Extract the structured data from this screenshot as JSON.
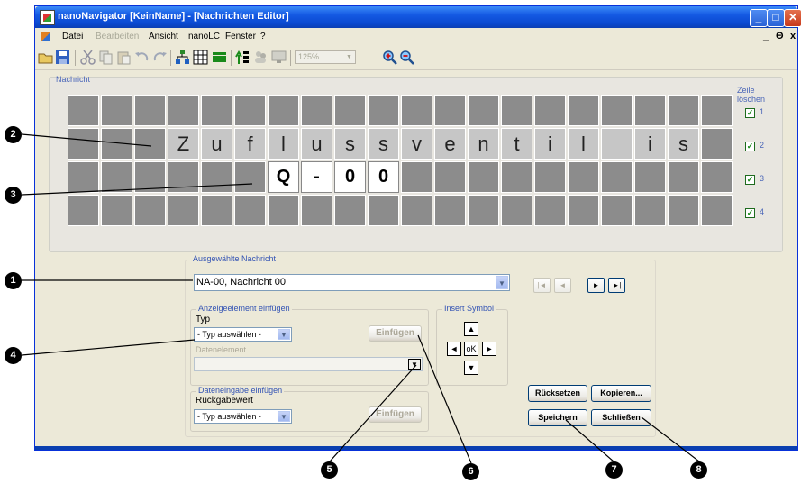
{
  "window": {
    "title": "nanoNavigator [KeinName] - [Nachrichten Editor]"
  },
  "menu": {
    "items": [
      {
        "label": "Datei",
        "enabled": true
      },
      {
        "label": "Bearbeiten",
        "enabled": false
      },
      {
        "label": "Ansicht",
        "enabled": true
      },
      {
        "label": "nanoLC",
        "enabled": true
      },
      {
        "label": "Fenster",
        "enabled": true
      },
      {
        "label": "?",
        "enabled": true
      }
    ],
    "mdi_controls": [
      "_",
      "Θ",
      "x"
    ]
  },
  "toolbar": {
    "zoom": "125%"
  },
  "message_panel": {
    "title": "Nachricht",
    "clear_rows_label": "Zeile löschen",
    "rows": [
      {
        "number": "1",
        "checked": true,
        "cells": [
          "",
          "",
          "",
          "",
          "",
          "",
          "",
          "",
          "",
          "",
          "",
          "",
          "",
          "",
          "",
          "",
          "",
          "",
          "",
          ""
        ]
      },
      {
        "number": "2",
        "checked": true,
        "cells": [
          "",
          "",
          "",
          "Z",
          "u",
          "f",
          "l",
          "u",
          "s",
          "s",
          "v",
          "e",
          "n",
          "t",
          "i",
          "l",
          "",
          "i",
          "s",
          ""
        ]
      },
      {
        "number": "3",
        "checked": true,
        "cells": [
          "",
          "",
          "",
          "",
          "",
          "",
          "Q",
          "-",
          "0",
          "0",
          "",
          "",
          "",
          "",
          "",
          "",
          "",
          "",
          "",
          ""
        ]
      },
      {
        "number": "4",
        "checked": true,
        "cells": [
          "",
          "",
          "",
          "",
          "",
          "",
          "",
          "",
          "",
          "",
          "",
          "",
          "",
          "",
          "",
          "",
          "",
          "",
          "",
          ""
        ]
      }
    ]
  },
  "selected_message": {
    "title": "Ausgewählte Nachricht",
    "value": "NA-00,  Nachricht 00"
  },
  "nav_buttons": [
    "|◄",
    "◄",
    "►",
    "►|"
  ],
  "insert_element": {
    "title": "Anzeigeelement einfügen",
    "type_label": "Typ",
    "type_value": "- Typ auswählen -",
    "data_label": "Datenelement",
    "button": "Einfügen"
  },
  "insert_symbol": {
    "title": "Insert Symbol",
    "ok": "oK"
  },
  "data_entry": {
    "title": "Dateneingabe einfügen",
    "return_label": "Rückgabewert",
    "type_value": "- Typ auswählen -",
    "button": "Einfügen"
  },
  "actions": {
    "reset": "Rücksetzen",
    "copy": "Kopieren...",
    "save": "Speichern",
    "close": "Schließen"
  },
  "callouts": [
    "1",
    "2",
    "3",
    "4",
    "5",
    "6",
    "7",
    "8"
  ]
}
